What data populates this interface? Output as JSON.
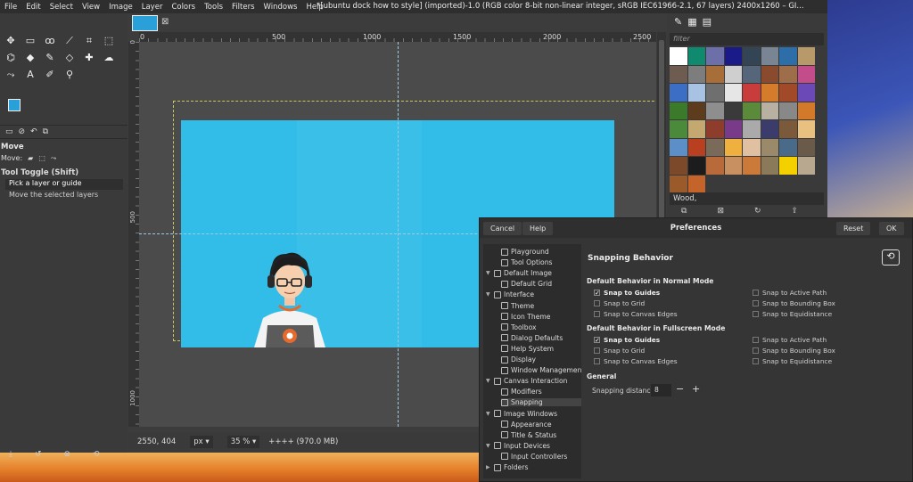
{
  "menubar": {
    "items": [
      "File",
      "Edit",
      "Select",
      "View",
      "Image",
      "Layer",
      "Colors",
      "Tools",
      "Filters",
      "Windows",
      "Help"
    ],
    "window_title": "*[ubuntu dock how to style] (imported)-1.0 (RGB color 8-bit non-linear integer, sRGB IEC61966-2.1, 67 layers) 2400x1260 – GI..."
  },
  "toolbox": {
    "tools": [
      "move-icon",
      "rect-select-icon",
      "lasso-icon",
      "fuzzy-select-icon",
      "crop-icon",
      "transform-icon",
      "warp-icon",
      "fill-icon",
      "paintbrush-icon",
      "eraser-icon",
      "heal-icon",
      "smudge-icon",
      "path-icon",
      "text-icon",
      "color-picker-icon",
      "magnify-icon"
    ],
    "tool_glyphs": [
      "✥",
      "▭",
      "ꝏ",
      "⟋",
      "⌗",
      "⬚",
      "⌬",
      "◆",
      "✎",
      "◇",
      "✚",
      "☁",
      "⤳",
      "A",
      "✐",
      "⚲"
    ],
    "fg_color": "#2aa0d8",
    "bg_color": "#ffffff",
    "options_title": "Move",
    "move_label": "Move:",
    "tool_toggle": "Tool Toggle  (Shift)",
    "options": [
      "Pick a layer or guide",
      "Move the selected layers"
    ]
  },
  "canvas": {
    "ruler_top": [
      "0",
      "500",
      "1000",
      "1500",
      "2000",
      "2500"
    ],
    "ruler_left": [
      "0",
      "500",
      "1000"
    ],
    "image_color": "#31bde8"
  },
  "statusbar": {
    "coords": "2550, 404",
    "unit": "px",
    "zoom": "35 %",
    "memory": "++++ (970.0 MB)"
  },
  "right_dock": {
    "filter_placeholder": "filter",
    "pattern_name": "Wood,",
    "patterns": [
      "#ffffff",
      "#0f8a6e",
      "#6c6fa8",
      "#1a1a88",
      "#334455",
      "#7a8594",
      "#2d6ea8",
      "#b89a6a",
      "#6e5c50",
      "#7d7d7d",
      "#a86e3a",
      "#cfcfcf",
      "#55657a",
      "#8a4a2e",
      "#9e6e4a",
      "#c24d8a",
      "#3c6ec6",
      "#a8c2e4",
      "#6f6f6f",
      "#e6e6e6",
      "#c83c3c",
      "#d47c2c",
      "#a04a2a",
      "#6b4ab8",
      "#3a7a2a",
      "#5c3c1c",
      "#8e8e8e",
      "#3a3a3a",
      "#5a8a3a",
      "#b8b0a0",
      "#888888",
      "#d27a2a",
      "#4a8a3a",
      "#c4a870",
      "#8e3c2c",
      "#7a3a8a",
      "#aaaaaa",
      "#3c3c6c",
      "#7a5a3a",
      "#e8c080",
      "#5c8ec8",
      "#b84020",
      "#7a6a5a",
      "#f0b040",
      "#e0c0a0",
      "#9a8a6a",
      "#4a6a8a",
      "#6a5a4a",
      "#7c4a2a",
      "#1c1c1c",
      "#b86a3a",
      "#c89060",
      "#cc7a3a",
      "#8a7a5a",
      "#f4d000",
      "#b8a890",
      "#9a5a2a",
      "#c4642a"
    ]
  },
  "prefs": {
    "cancel": "Cancel",
    "help": "Help",
    "title": "Preferences",
    "reset": "Reset",
    "ok": "OK",
    "tree": [
      {
        "label": "Playground",
        "icon": "playground-icon"
      },
      {
        "label": "Tool Options",
        "icon": "tool-options-icon"
      },
      {
        "label": "Default Image",
        "icon": "default-image-icon"
      },
      {
        "label": "Default Grid",
        "icon": "grid-icon"
      },
      {
        "label": "Interface",
        "icon": "interface-icon"
      },
      {
        "label": "Theme",
        "icon": "theme-icon"
      },
      {
        "label": "Icon Theme",
        "icon": "icon-theme-icon"
      },
      {
        "label": "Toolbox",
        "icon": "toolbox-icon"
      },
      {
        "label": "Dialog Defaults",
        "icon": "dialog-defaults-icon"
      },
      {
        "label": "Help System",
        "icon": "help-system-icon"
      },
      {
        "label": "Display",
        "icon": "display-icon"
      },
      {
        "label": "Window Management",
        "icon": "window-mgmt-icon"
      },
      {
        "label": "Canvas Interaction",
        "icon": "canvas-interaction-icon"
      },
      {
        "label": "Modifiers",
        "icon": "modifiers-icon"
      },
      {
        "label": "Snapping",
        "icon": "snapping-icon"
      },
      {
        "label": "Image Windows",
        "icon": "image-windows-icon"
      },
      {
        "label": "Appearance",
        "icon": "appearance-icon"
      },
      {
        "label": "Title & Status",
        "icon": "title-status-icon"
      },
      {
        "label": "Input Devices",
        "icon": "input-devices-icon"
      },
      {
        "label": "Input Controllers",
        "icon": "input-controllers-icon"
      },
      {
        "label": "Folders",
        "icon": "folders-icon"
      }
    ],
    "page_title": "Snapping Behavior",
    "normal_heading": "Default Behavior in Normal Mode",
    "fullscreen_heading": "Default Behavior in Fullscreen Mode",
    "general_heading": "General",
    "left_options": [
      {
        "label": "Snap to Guides",
        "checked": true
      },
      {
        "label": "Snap to Grid",
        "checked": false
      },
      {
        "label": "Snap to Canvas Edges",
        "checked": false
      }
    ],
    "right_options": [
      {
        "label": "Snap to Active Path",
        "checked": false
      },
      {
        "label": "Snap to Bounding Box",
        "checked": false
      },
      {
        "label": "Snap to Equidistance",
        "checked": false
      }
    ],
    "distance_label": "Snapping distance:",
    "distance_value": "8"
  }
}
